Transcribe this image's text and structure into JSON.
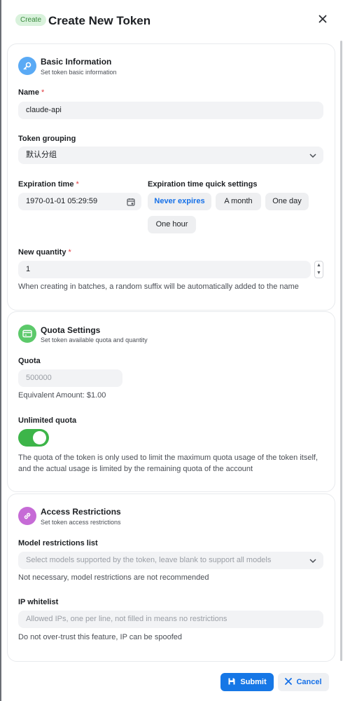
{
  "header": {
    "badge": "Create",
    "title": "Create New Token"
  },
  "basic": {
    "title": "Basic Information",
    "subtitle": "Set token basic information",
    "name_label": "Name",
    "name_value": "claude-api",
    "group_label": "Token grouping",
    "group_value": "默认分组",
    "expiration_label": "Expiration time",
    "expiration_value": "1970-01-01 05:29:59",
    "quick_label": "Expiration time quick settings",
    "quick_options": [
      "Never expires",
      "A month",
      "One day",
      "One hour"
    ],
    "quantity_label": "New quantity",
    "quantity_value": "1",
    "quantity_helper": "When creating in batches, a random suffix will be automatically added to the name"
  },
  "quota": {
    "title": "Quota Settings",
    "subtitle": "Set token available quota and quantity",
    "quota_label": "Quota",
    "quota_placeholder": "500000",
    "equivalent": "Equivalent Amount: $1.00",
    "unlimited_label": "Unlimited quota",
    "unlimited_on": true,
    "unlimited_helper": "The quota of the token is only used to limit the maximum quota usage of the token itself, and the actual usage is limited by the remaining quota of the account"
  },
  "access": {
    "title": "Access Restrictions",
    "subtitle": "Set token access restrictions",
    "model_label": "Model restrictions list",
    "model_placeholder": "Select models supported by the token, leave blank to support all models",
    "model_helper": "Not necessary, model restrictions are not recommended",
    "ip_label": "IP whitelist",
    "ip_placeholder": "Allowed IPs, one per line, not filled in means no restrictions",
    "ip_helper": "Do not over-trust this feature, IP can be spoofed"
  },
  "footer": {
    "submit": "Submit",
    "cancel": "Cancel"
  },
  "colors": {
    "primary": "#1677e6",
    "basic_icon": "#5aaaf5",
    "quota_icon": "#5cc96a",
    "access_icon": "#c66bd6",
    "toggle_on": "#3db549"
  },
  "icons": {
    "basic": "key-icon",
    "quota": "card-icon",
    "access": "link-icon",
    "close": "close-icon",
    "calendar": "calendar-icon",
    "submit": "save-icon",
    "cancel": "x-icon"
  }
}
